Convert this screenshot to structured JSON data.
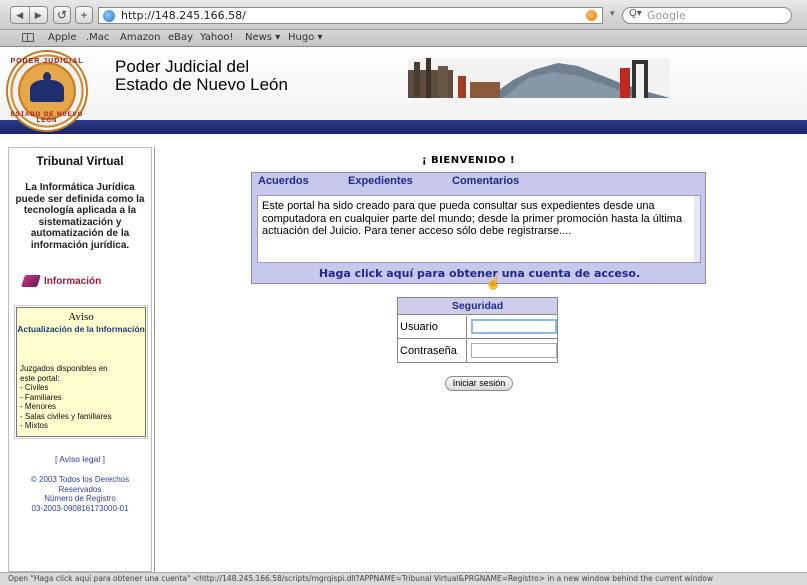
{
  "browser": {
    "url": "http://148.245.166.58/",
    "search_placeholder": "Google",
    "back_icon": "back-arrow",
    "forward_icon": "forward-arrow",
    "reload_label": "↺",
    "add_label": "+",
    "bookmarks": [
      "Apple",
      ".Mac",
      "Amazon",
      "eBay",
      "Yahoo!",
      "News ▾",
      "Hugo ▾"
    ],
    "status_text": "Open \"Haga click aquí para obtener una cuenta\" <http://148.245.166.58/scripts/mgrqispi.dll?APPNAME=Tribunal Virtual&PRGNAME=Registro> in a new window behind the current window"
  },
  "header": {
    "seal_top": "PODER JUDICIAL",
    "seal_bottom": "ESTADO DE NUEVO LEÓN",
    "title_line1": "Poder Judicial del",
    "title_line2": "Estado de Nuevo León",
    "bar_color": "#1a2466"
  },
  "sidebar": {
    "title": "Tribunal Virtual",
    "description": "La Informática Jurídica puede ser definida como la tecnología aplicada a la sistematización y automatización de la información jurídica.",
    "info_link": "Información",
    "aviso": {
      "heading": "Aviso",
      "subheading": "Actualización de la Información",
      "intro_1": "Juzgados disponibles en",
      "intro_2": "este portal:",
      "items": [
        "- Civiles",
        "- Familiares",
        "- Menores",
        "- Salas civiles y familiares",
        "- Mixtos"
      ]
    },
    "legal_link": "[ Aviso legal ]",
    "copyright_1": "© 2003 Todos los Derechos",
    "copyright_2": "Reservados",
    "copyright_3": "Número de Registro",
    "copyright_4": "03-2003-090816173000-01"
  },
  "main": {
    "welcome": "¡ BIENVENIDO !",
    "tabs": [
      "Acuerdos",
      "Expedientes",
      "Comentarios"
    ],
    "body_text": "Este portal ha sido creado para que pueda consultar sus expedientes desde una computadora en cualquier parte del mundo; desde la primer promoción hasta la última actuación del Juicio. Para tener acceso sólo debe registrarse....",
    "register_link": "Haga click aquí para obtener una cuenta de acceso.",
    "accent_color": "#1d2a8e",
    "panel_color": "#c8c8ec"
  },
  "login": {
    "heading": "Seguridad",
    "user_label": "Usuario",
    "pass_label": "Contraseña",
    "user_value": "",
    "pass_value": "",
    "submit_label": "Iniciar sesión"
  }
}
